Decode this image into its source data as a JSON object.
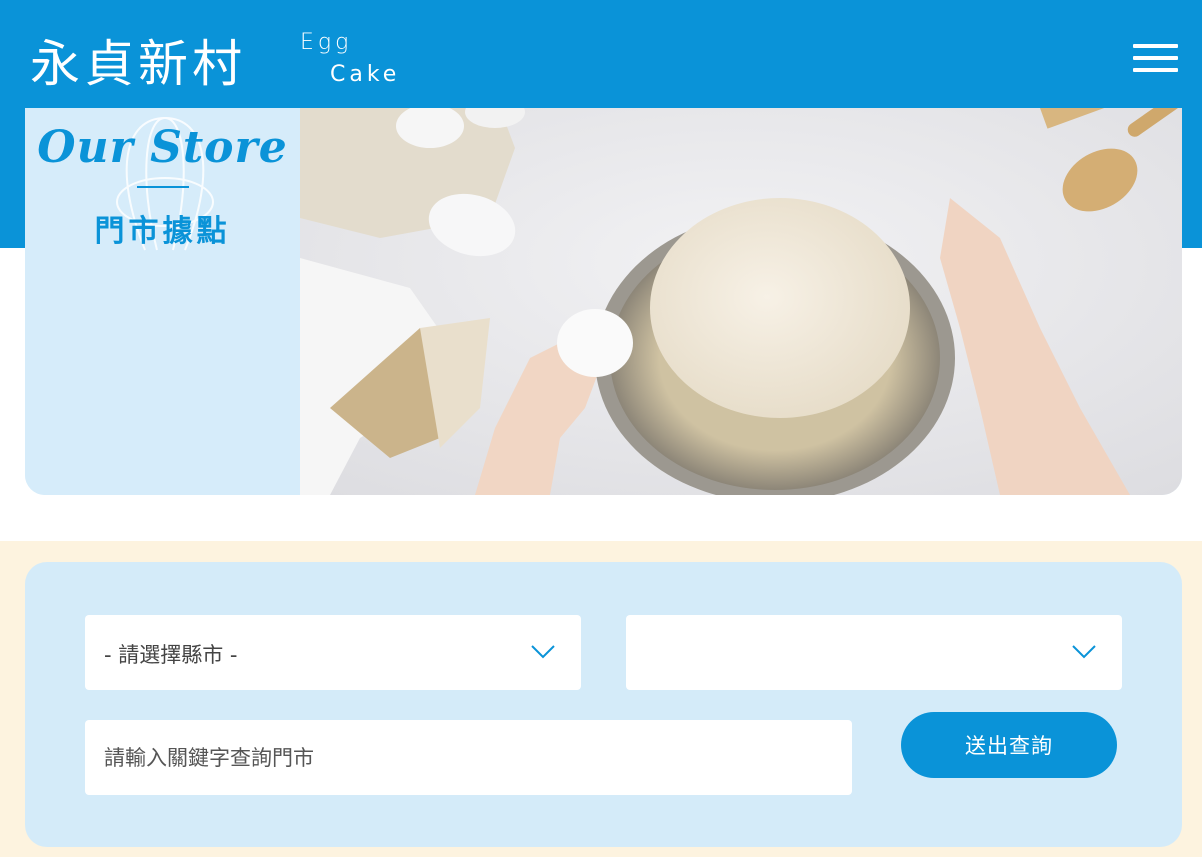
{
  "header": {
    "logo_cn": "永貞新村",
    "logo_en_1": "Egg",
    "logo_en_2": "Cake",
    "menu_icon": "hamburger-menu-icon"
  },
  "hero": {
    "title_en": "Our Store",
    "title_cn": "門市據點",
    "image": "baking-flour-eggs-photo"
  },
  "search": {
    "city_select": "- 請選擇縣市 -",
    "district_select": "",
    "keyword_placeholder": "請輸入關鍵字查詢門市",
    "submit_label": "送出查詢"
  },
  "colors": {
    "brand_blue": "#0a93d8",
    "light_blue": "#d4ebf9",
    "cream": "#fdf3df"
  }
}
